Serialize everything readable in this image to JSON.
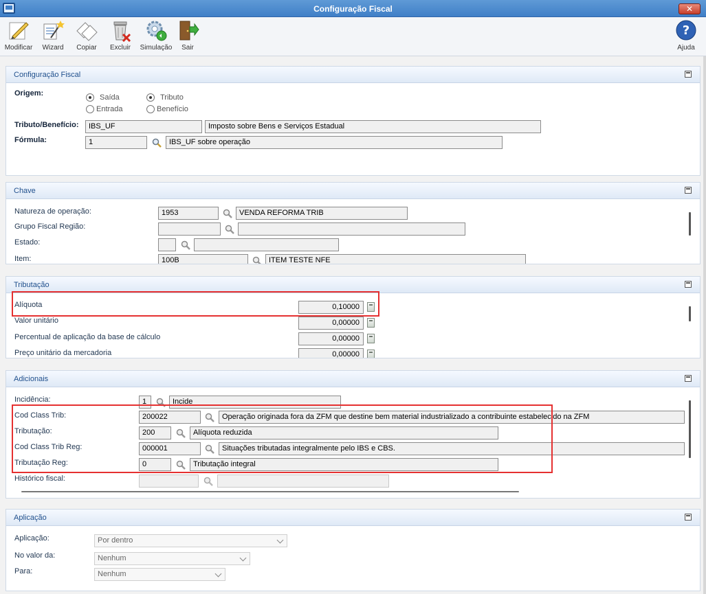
{
  "window": {
    "title": "Configuração Fiscal",
    "close_label": "✕"
  },
  "toolbar": {
    "modificar": "Modificar",
    "wizard": "Wizard",
    "copiar": "Copiar",
    "excluir": "Excluir",
    "simulacao": "Simulação",
    "sair": "Sair",
    "ajuda": "Ajuda"
  },
  "config": {
    "title": "Configuração Fiscal",
    "origem_label": "Origem:",
    "radio_saida": "Saída",
    "radio_entrada": "Entrada",
    "radio_tributo": "Tributo",
    "radio_beneficio": "Benefício",
    "tributo_label": "Tributo/Benefício:",
    "tributo_code": "IBS_UF",
    "tributo_desc": "Imposto sobre Bens e Serviços Estadual",
    "formula_label": "Fórmula:",
    "formula_code": "1",
    "formula_desc": "IBS_UF sobre operação"
  },
  "chave": {
    "title": "Chave",
    "natureza_label": "Natureza de operação:",
    "natureza_code": "1953",
    "natureza_desc": "VENDA REFORMA TRIB",
    "grupo_label": "Grupo Fiscal Região:",
    "grupo_code": "",
    "grupo_desc": "",
    "estado_label": "Estado:",
    "estado_code": "",
    "estado_desc": "",
    "item_label": "Item:",
    "item_code": "100B",
    "item_desc": "ITEM TESTE NFE"
  },
  "tributacao": {
    "title": "Tributação",
    "aliquota_label": "Alíquota",
    "aliquota_value": "0,10000",
    "valor_unit_label": "Valor unitário",
    "valor_unit_value": "0,00000",
    "perc_base_label": "Percentual de aplicação da base de cálculo",
    "perc_base_value": "0,00000",
    "preco_unit_label": "Preço unitário da mercadoria",
    "preco_unit_value": "0,00000"
  },
  "adicionais": {
    "title": "Adicionais",
    "incidencia_label": "Incidência:",
    "incidencia_code": "1",
    "incidencia_desc": "Incide",
    "cct_label": "Cod Class Trib:",
    "cct_code": "200022",
    "cct_desc": "Operação originada fora da ZFM que destine bem material industrializado a contribuinte estabelecido na ZFM",
    "trib_label": "Tributação:",
    "trib_code": "200",
    "trib_desc": "Alíquota reduzida",
    "cctr_label": "Cod Class Trib Reg:",
    "cctr_code": "000001",
    "cctr_desc": "Situações tributadas integralmente pelo IBS e CBS.",
    "tribr_label": "Tributação Reg:",
    "tribr_code": "0",
    "tribr_desc": "Tributação integral",
    "hist_label": "Histórico fiscal:",
    "hist_code": "",
    "hist_desc": ""
  },
  "aplicacao": {
    "title": "Aplicação",
    "aplicacao_label": "Aplicação:",
    "aplicacao_value": "Por dentro",
    "valor_da_label": "No valor da:",
    "valor_da_value": "Nenhum",
    "para_label": "Para:",
    "para_value": "Nenhum"
  },
  "colors": {
    "highlight": "#e53030",
    "panel_title": "#1f4f8c",
    "titlebar": "#4f8ccf"
  }
}
